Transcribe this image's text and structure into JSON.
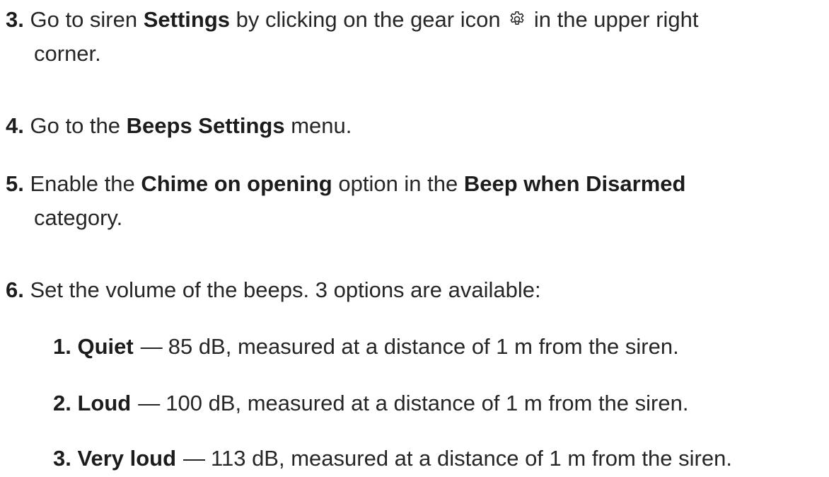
{
  "steps": [
    {
      "num": "3.",
      "pre": "Go to siren",
      "bold1": "Settings",
      "mid": "by clicking on the gear icon",
      "icon": "gear-icon",
      "post": "in the upper right",
      "cont": "corner."
    },
    {
      "num": "4.",
      "pre": "Go to the",
      "bold1": "Beeps Settings",
      "post": "menu."
    },
    {
      "num": "5.",
      "pre": "Enable the",
      "bold1": "Chime on opening",
      "mid": "option in the",
      "bold2": "Beep when Disarmed",
      "cont": "category."
    },
    {
      "num": "6.",
      "text": "Set the volume of the beeps. 3 options are available:"
    }
  ],
  "options": [
    {
      "num": "1.",
      "name": "Quiet",
      "dash": "—",
      "desc": "85 dB, measured at a distance of 1 m from the siren."
    },
    {
      "num": "2.",
      "name": "Loud",
      "dash": "—",
      "desc": "100 dB, measured at a distance of 1 m from the siren."
    },
    {
      "num": "3.",
      "name": "Very loud",
      "dash": "—",
      "desc": "113 dB, measured at a distance of 1 m from the siren."
    }
  ]
}
